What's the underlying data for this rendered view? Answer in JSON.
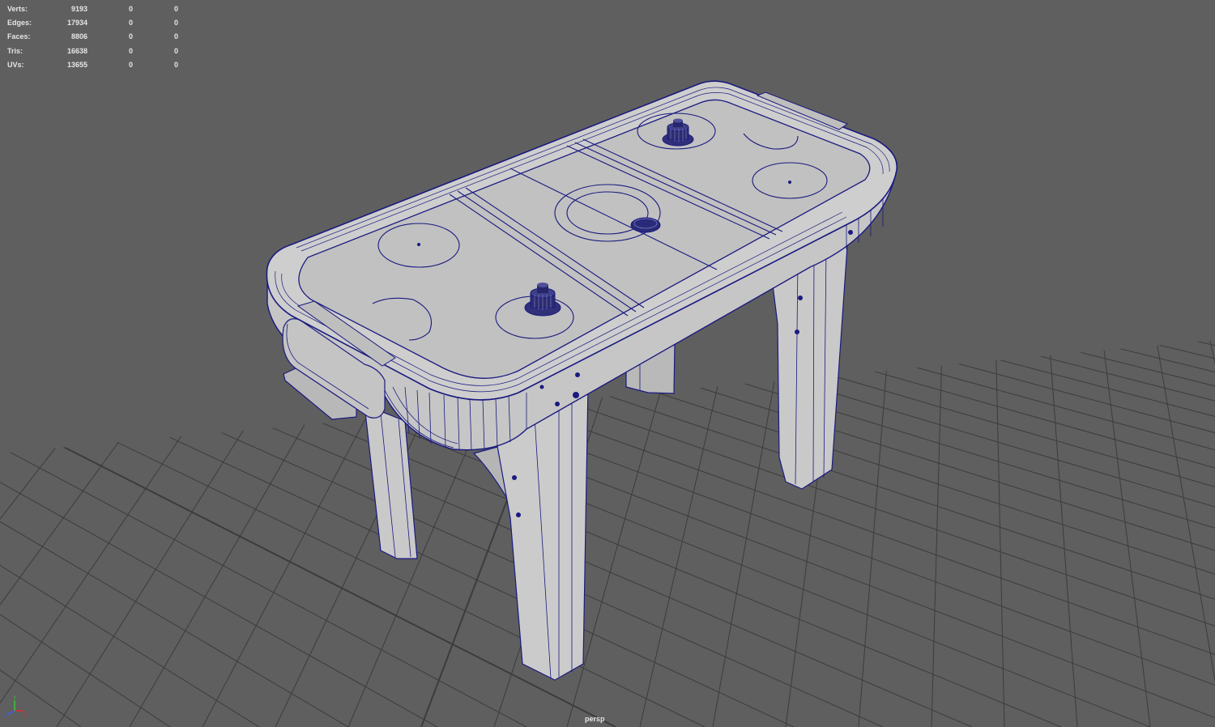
{
  "viewport": {
    "camera": "persp",
    "background_color": "#5f5f5f",
    "grid_color": "#3c3c3c",
    "wire_color": "#1a1a80"
  },
  "hud": {
    "rows": [
      {
        "label": "Verts:",
        "values": [
          "9193",
          "0",
          "0"
        ]
      },
      {
        "label": "Edges:",
        "values": [
          "17934",
          "0",
          "0"
        ]
      },
      {
        "label": "Faces:",
        "values": [
          "8806",
          "0",
          "0"
        ]
      },
      {
        "label": "Tris:",
        "values": [
          "16638",
          "0",
          "0"
        ]
      },
      {
        "label": "UVs:",
        "values": [
          "13655",
          "0",
          "0"
        ]
      }
    ]
  },
  "axis_gizmo": {
    "x_color": "#d83030",
    "y_color": "#40c040",
    "z_color": "#4060e0",
    "x_label": "X",
    "y_label": "Y",
    "z_label": "Z"
  },
  "model": {
    "name": "air-hockey-table",
    "icons": [
      "mallet-icon",
      "puck-icon"
    ]
  }
}
